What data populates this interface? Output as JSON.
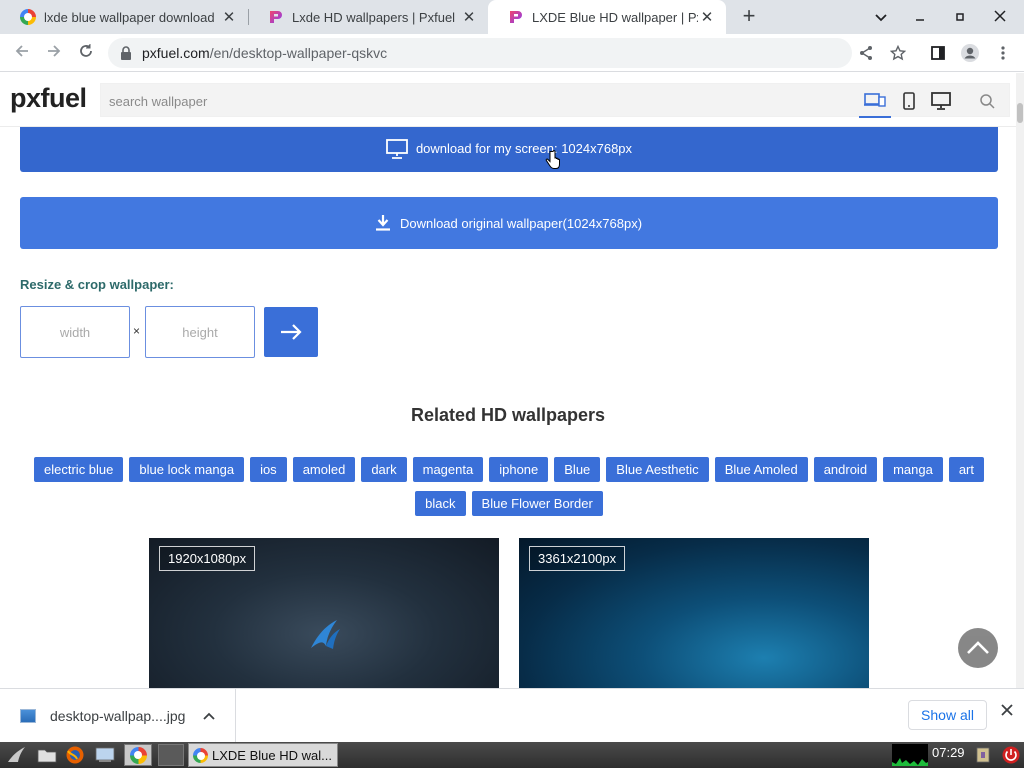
{
  "browser": {
    "tabs": [
      {
        "title": "lxde blue wallpaper download",
        "favicon": "google-g-icon",
        "active": false
      },
      {
        "title": "Lxde HD wallpapers | Pxfuel",
        "favicon": "pxfuel-icon",
        "active": false
      },
      {
        "title": "LXDE Blue HD wallpaper | Pxfuel",
        "favicon": "pxfuel-icon",
        "active": true
      }
    ],
    "new_tab_label": "+",
    "url_host": "pxfuel.com",
    "url_path": "/en/desktop-wallpaper-qskvc"
  },
  "site": {
    "logo": "pxfuel",
    "search_placeholder": "search wallpaper",
    "download_screen_label": "download for my screen: 1024x768px",
    "download_original_label": "Download original wallpaper(1024x768px)",
    "resize_label": "Resize & crop wallpaper:",
    "width_placeholder": "width",
    "height_placeholder": "height",
    "times_symbol": "×",
    "related_title": "Related HD wallpapers",
    "tags": [
      "electric blue",
      "blue lock manga",
      "ios",
      "amoled",
      "dark",
      "magenta",
      "iphone",
      "Blue",
      "Blue Aesthetic",
      "Blue Amoled",
      "android",
      "manga",
      "art",
      "black",
      "Blue Flower Border"
    ],
    "thumbnails": [
      {
        "resolution": "1920x1080px"
      },
      {
        "resolution": "3361x2100px"
      }
    ],
    "accent_color": "#3a6fd8"
  },
  "download_shelf": {
    "file_name": "desktop-wallpap....jpg",
    "show_all_label": "Show all"
  },
  "taskbar": {
    "active_task_title": "LXDE Blue HD wal...",
    "clock": "07:29"
  }
}
